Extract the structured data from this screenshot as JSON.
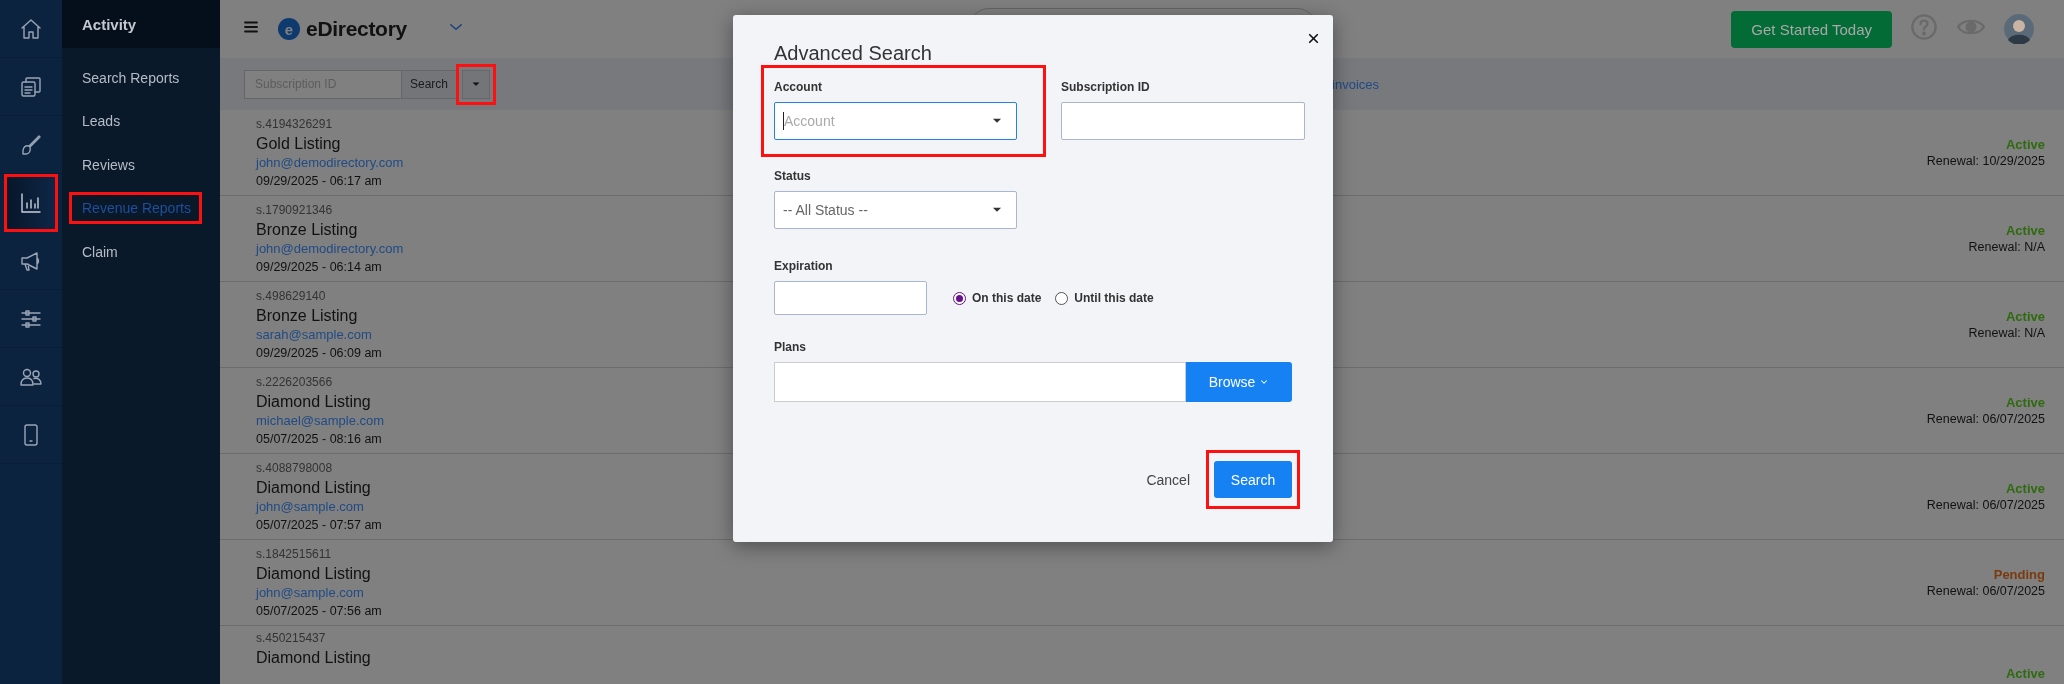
{
  "rail": [
    {
      "kind": "home",
      "selected": false,
      "highlighted": false
    },
    {
      "kind": "pages",
      "selected": false,
      "highlighted": false
    },
    {
      "kind": "brush",
      "selected": false,
      "highlighted": false
    },
    {
      "kind": "chart",
      "selected": true,
      "highlighted": true
    },
    {
      "kind": "megaphone",
      "selected": false,
      "highlighted": false
    },
    {
      "kind": "sliders",
      "selected": false,
      "highlighted": false
    },
    {
      "kind": "users",
      "selected": false,
      "highlighted": false
    },
    {
      "kind": "mobile",
      "selected": false,
      "highlighted": false
    }
  ],
  "submenu": {
    "title": "Activity",
    "items": [
      {
        "label": "Search Reports",
        "selected": false,
        "highlighted": false
      },
      {
        "label": "Leads",
        "selected": false,
        "highlighted": false
      },
      {
        "label": "Reviews",
        "selected": false,
        "highlighted": false
      },
      {
        "label": "Revenue Reports",
        "selected": true,
        "highlighted": true
      },
      {
        "label": "Claim",
        "selected": false,
        "highlighted": false
      }
    ]
  },
  "topbar": {
    "logo_letter": "e",
    "brand": "eDirectory",
    "cta": "Get Started Today"
  },
  "filter": {
    "placeholder": "Subscription ID",
    "search_button": "Search",
    "dropdown_highlighted": true,
    "link": "invoices"
  },
  "rows": [
    {
      "id": "s.4194326291",
      "title": "Gold Listing",
      "email": "john@demodirectory.com",
      "date": "09/29/2025 - 06:17 am",
      "status": "Active",
      "color": "#2f6a0f",
      "renewal": "Renewal: 10/29/2025"
    },
    {
      "id": "s.1790921346",
      "title": "Bronze Listing",
      "email": "john@demodirectory.com",
      "date": "09/29/2025 - 06:14 am",
      "status": "Active",
      "color": "#2f6a0f",
      "renewal": "Renewal: N/A"
    },
    {
      "id": "s.498629140",
      "title": "Bronze Listing",
      "email": "sarah@sample.com",
      "date": "09/29/2025 - 06:09 am",
      "status": "Active",
      "color": "#2f6a0f",
      "renewal": "Renewal: N/A"
    },
    {
      "id": "s.2226203566",
      "title": "Diamond Listing",
      "email": "michael@sample.com",
      "date": "05/07/2025 - 08:16 am",
      "status": "Active",
      "color": "#2f6a0f",
      "renewal": "Renewal: 06/07/2025"
    },
    {
      "id": "s.4088798008",
      "title": "Diamond Listing",
      "email": "john@sample.com",
      "date": "05/07/2025 - 07:57 am",
      "status": "Active",
      "color": "#2f6a0f",
      "renewal": "Renewal: 06/07/2025"
    },
    {
      "id": "s.1842515611",
      "title": "Diamond Listing",
      "email": "john@sample.com",
      "date": "05/07/2025 - 07:56 am",
      "status": "Pending",
      "color": "#7a3a0e",
      "renewal": "Renewal: 06/07/2025"
    },
    {
      "id": "s.450215437",
      "title": "Diamond Listing",
      "status": "Active",
      "color": "#2f6a0f"
    }
  ],
  "modal": {
    "title": "Advanced Search",
    "account": {
      "label": "Account",
      "placeholder": "Account",
      "focused": true,
      "highlighted": true
    },
    "subscription_id": {
      "label": "Subscription ID"
    },
    "status": {
      "label": "Status",
      "value": "-- All Status --"
    },
    "expiration": {
      "label": "Expiration",
      "options": [
        {
          "label": "On this date",
          "selected": true
        },
        {
          "label": "Until this date",
          "selected": false
        }
      ]
    },
    "plans": {
      "label": "Plans",
      "button": "Browse"
    },
    "cancel": "Cancel",
    "submit": "Search",
    "submit_highlighted": true
  }
}
